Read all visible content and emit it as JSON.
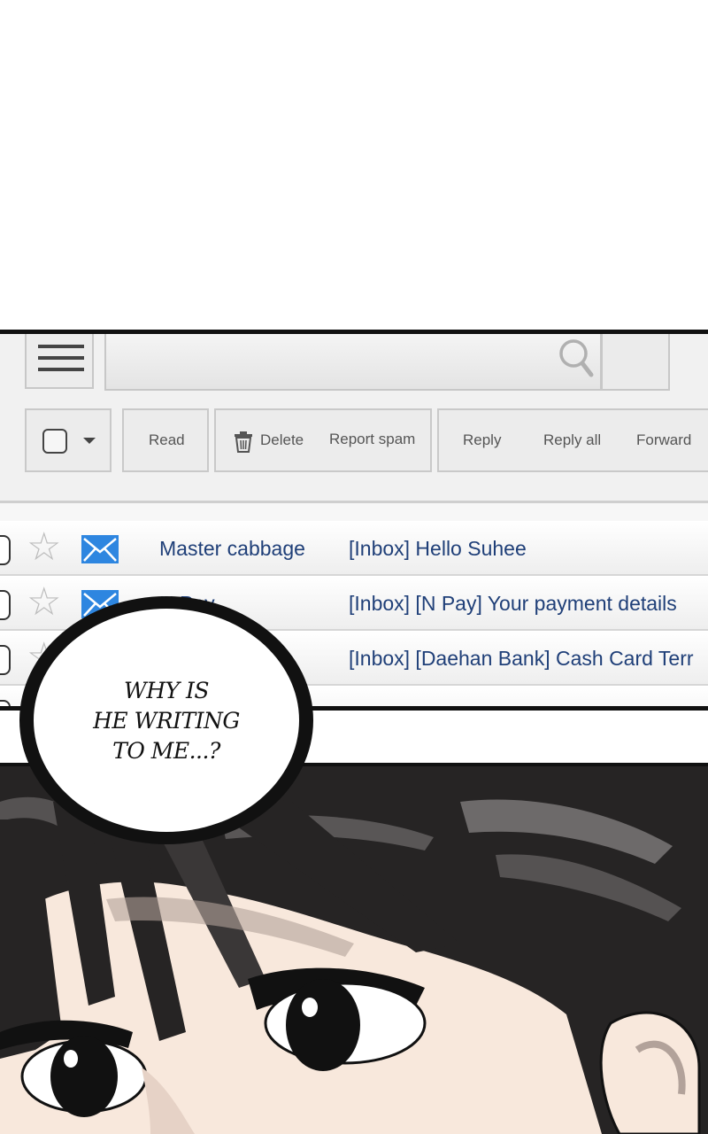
{
  "toolbar": {
    "read_label": "Read",
    "delete_label": "Delete",
    "report_spam_label": "Report spam",
    "reply_label": "Reply",
    "reply_all_label": "Reply all",
    "forward_label": "Forward"
  },
  "icons": {
    "menu": "hamburger-icon",
    "search": "search-icon",
    "trash": "trash-icon",
    "star": "star-icon",
    "mail": "envelope-icon",
    "dropdown": "caret-down-icon"
  },
  "colors": {
    "link_text": "#1f3f78",
    "envelope": "#2e86e0"
  },
  "emails": [
    {
      "sender": "Master cabbage",
      "subject": "[Inbox] Hello Suhee"
    },
    {
      "sender": "N Pay",
      "subject": "[Inbox] [N Pay] Your payment details"
    },
    {
      "sender": "",
      "subject": "[Inbox] [Daehan Bank] Cash Card Terr"
    }
  ],
  "speech_bubble": {
    "line1": "WHY IS",
    "line2": "HE WRITING",
    "line3": "TO ME...?"
  }
}
